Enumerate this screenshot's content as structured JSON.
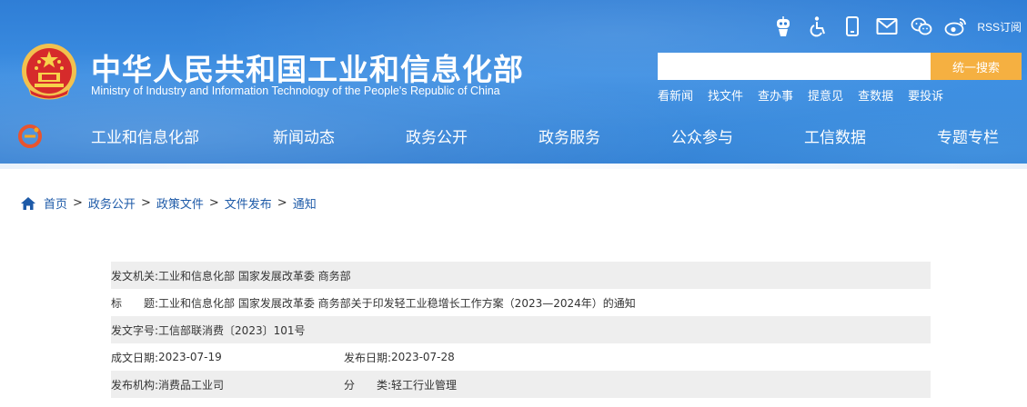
{
  "header": {
    "title": "中华人民共和国工业和信息化部",
    "subtitle": "Ministry of Industry and Information Technology of the People's Republic of China",
    "rss_label": "RSS订阅",
    "search": {
      "placeholder": "",
      "button_label": "统一搜索"
    },
    "quick_links": [
      "看新闻",
      "找文件",
      "查办事",
      "提意见",
      "查数据",
      "要投诉"
    ],
    "top_icons": [
      "robot-assistant-icon",
      "accessibility-icon",
      "mobile-icon",
      "mail-icon",
      "wechat-icon",
      "weibo-icon"
    ],
    "colors": {
      "header_blue": "#3c8ee2",
      "search_button": "#f5b041",
      "link_blue": "#1d5aa8"
    }
  },
  "nav": {
    "items": [
      "工业和信息化部",
      "新闻动态",
      "政务公开",
      "政务服务",
      "公众参与",
      "工信数据",
      "专题专栏"
    ]
  },
  "breadcrumb": {
    "items": [
      "首页",
      "政务公开",
      "政策文件",
      "文件发布",
      "通知"
    ],
    "separator": ">"
  },
  "info": {
    "issuer_label": "发文机关:",
    "issuer": "工业和信息化部 国家发展改革委 商务部",
    "title_label": "标　　题:",
    "title": "工业和信息化部 国家发展改革委 商务部关于印发轻工业稳增长工作方案（2023—2024年）的通知",
    "doc_no_label": "发文字号:",
    "doc_no": "工信部联消费〔2023〕101号",
    "written_date_label": "成文日期:",
    "written_date": "2023-07-19",
    "publish_date_label": "发布日期:",
    "publish_date": "2023-07-28",
    "agency_label": "发布机构:",
    "agency": "消费品工业司",
    "category_label": "分　　类:",
    "category": "轻工行业管理"
  }
}
